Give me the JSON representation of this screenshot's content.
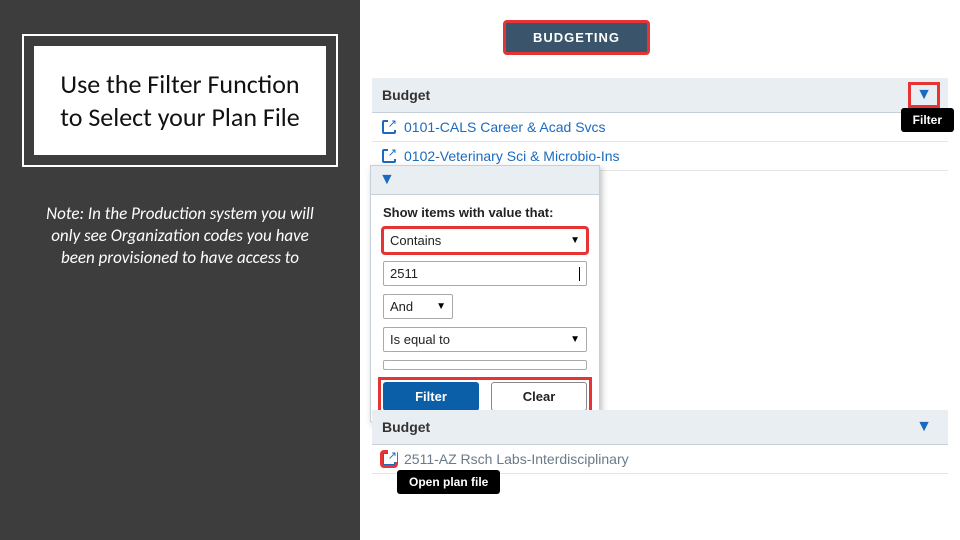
{
  "sidebar": {
    "title": "Use the Filter Function to Select your Plan File",
    "note": "Note: In the Production system you will only see Organization codes you have been provisioned to have access to"
  },
  "topTab": {
    "label": "BUDGETING"
  },
  "panel1": {
    "header": "Budget",
    "rows": [
      {
        "label": "0101-CALS Career & Acad Svcs"
      },
      {
        "label": "0102-Veterinary Sci & Microbio-Ins"
      }
    ],
    "filterTooltip": "Filter"
  },
  "filterPopup": {
    "title": "Show items with value that:",
    "condition1": "Contains",
    "value1": "2511",
    "joiner": "And",
    "condition2": "Is equal to",
    "value2": "",
    "btnFilter": "Filter",
    "btnClear": "Clear"
  },
  "panel2": {
    "header": "Budget",
    "row": {
      "label": "2511-AZ Rsch Labs-Interdisciplinary"
    },
    "openFileTooltip": "Open plan file"
  }
}
